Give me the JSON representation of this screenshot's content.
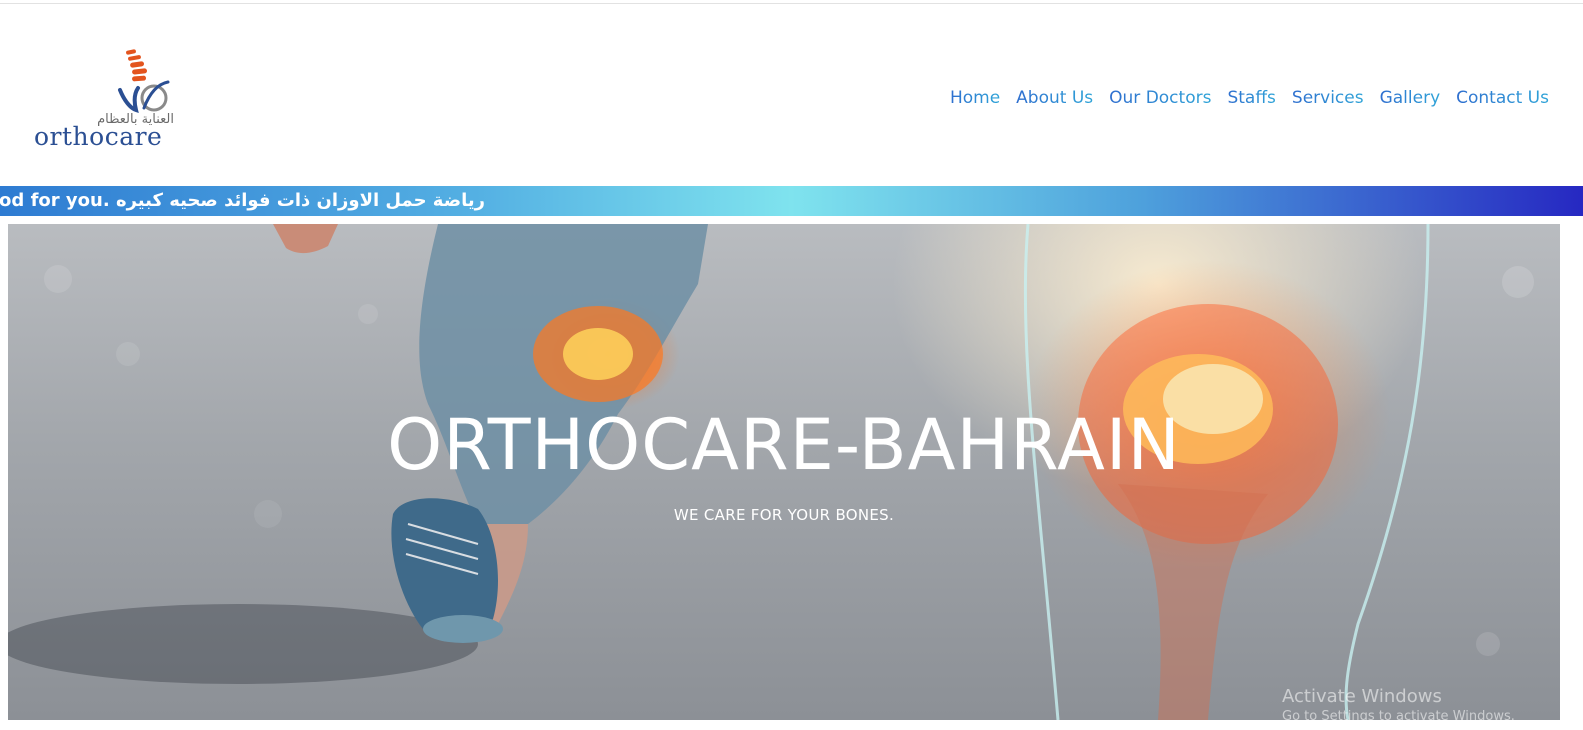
{
  "brand": {
    "name": "orthocare",
    "tagline_arabic": "العناية بالعظام"
  },
  "nav": {
    "items": [
      {
        "label": "Home"
      },
      {
        "label": "About Us"
      },
      {
        "label": "Our Doctors"
      },
      {
        "label": "Staffs"
      },
      {
        "label": "Services"
      },
      {
        "label": "Gallery"
      },
      {
        "label": "Contact Us"
      }
    ]
  },
  "ticker": {
    "text": "re good for you. رياضة حمل الاوزان ذات فوائد صحيه كبيره"
  },
  "hero": {
    "title": "ORTHOCARE-BAHRAIN",
    "subtitle": "WE CARE FOR YOUR BONES."
  },
  "os_watermark": {
    "line1": "Activate Windows",
    "line2": "Go to Settings to activate Windows."
  },
  "colors": {
    "nav_link": "#2f8fd8",
    "logo_blue": "#2b4f93",
    "logo_orange": "#e3541e",
    "ticker_start": "#2e7bd2",
    "ticker_mid": "#7fe3ee",
    "ticker_end": "#2628c2"
  }
}
